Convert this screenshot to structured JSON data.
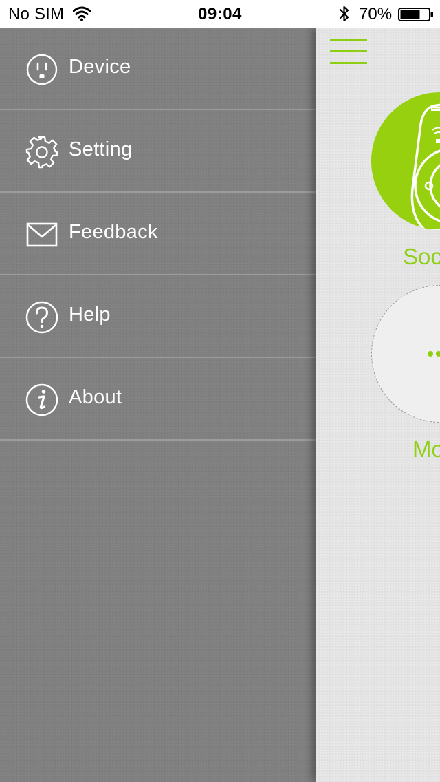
{
  "status_bar": {
    "carrier": "No SIM",
    "time": "09:04",
    "battery_percent": "70%",
    "battery_level": 0.7,
    "icons": [
      "wifi-icon",
      "bluetooth-icon",
      "battery-icon"
    ]
  },
  "side_menu": {
    "items": [
      {
        "label": "Device",
        "icon": "power-outlet-icon"
      },
      {
        "label": "Setting",
        "icon": "gear-icon"
      },
      {
        "label": "Feedback",
        "icon": "envelope-icon"
      },
      {
        "label": "Help",
        "icon": "question-mark-icon"
      },
      {
        "label": "About",
        "icon": "info-icon"
      }
    ]
  },
  "main": {
    "menu_icon": "hamburger-menu-icon",
    "devices": [
      {
        "label": "Soc",
        "icon": "smart-plug-icon"
      },
      {
        "label": "Mo",
        "icon": "more-dots-icon"
      }
    ]
  },
  "colors": {
    "accent": "#8ecf14",
    "menu_background": "#808080",
    "menu_divider": "#9c9c9c",
    "main_background": "#e3e3e3",
    "status_bar_background": "#ffffff"
  }
}
